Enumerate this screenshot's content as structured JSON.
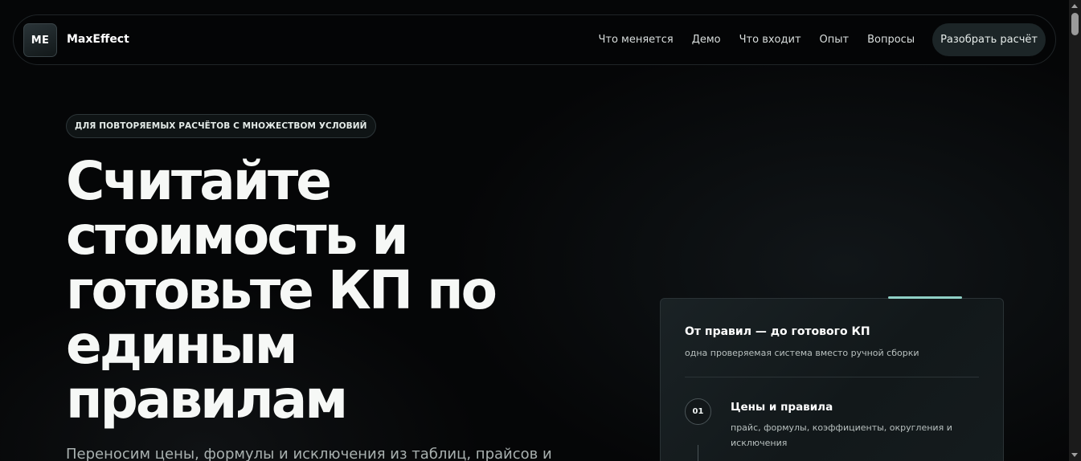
{
  "header": {
    "logo_text": "ME",
    "brand_name": "MaxEffect",
    "nav": [
      {
        "label": "Что меняется"
      },
      {
        "label": "Демо"
      },
      {
        "label": "Что входит"
      },
      {
        "label": "Опыт"
      },
      {
        "label": "Вопросы"
      }
    ],
    "cta_label": "Разобрать расчёт"
  },
  "hero": {
    "eyebrow": "ДЛЯ ПОВТОРЯЕМЫХ РАСЧЁТОВ С МНОЖЕСТВОМ УСЛОВИЙ",
    "title_lines": [
      "Считайте",
      "стоимость и",
      "готовьте КП по",
      "единым",
      "правилам"
    ],
    "subtitle": "Переносим цены, формулы и исключения из таблиц, прайсов и"
  },
  "card": {
    "title": "От правил — до готового КП",
    "subtitle": "одна проверяемая система вместо ручной сборки",
    "steps": [
      {
        "number": "01",
        "title": "Цены и правила",
        "description": "прайс, формулы, коэффициенты, округления и исключения"
      }
    ]
  },
  "colors": {
    "background": "#050607",
    "accent": "#8fd0c6",
    "cta_background": "#1c2527"
  },
  "icons": {
    "scroll_up": "triangle-up-icon",
    "scroll_down": "triangle-down-icon"
  }
}
